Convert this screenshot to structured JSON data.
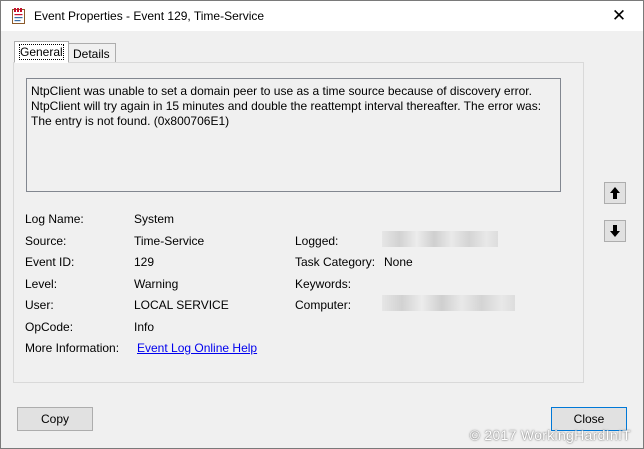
{
  "window": {
    "title": "Event Properties - Event 129, Time-Service",
    "close_glyph": "✕"
  },
  "tabs": [
    {
      "label": "General",
      "selected": true
    },
    {
      "label": "Details",
      "selected": false
    }
  ],
  "description": "NtpClient was unable to set a domain peer to use as a time source because of discovery error. NtpClient will try again in 15 minutes and double the reattempt interval thereafter. The error was: The entry is not found. (0x800706E1)",
  "fields": {
    "log_name": {
      "label": "Log Name:",
      "value": "System"
    },
    "source": {
      "label": "Source:",
      "value": "Time-Service"
    },
    "event_id": {
      "label": "Event ID:",
      "value": "129"
    },
    "level": {
      "label": "Level:",
      "value": "Warning"
    },
    "user": {
      "label": "User:",
      "value": "LOCAL SERVICE"
    },
    "opcode": {
      "label": "OpCode:",
      "value": "Info"
    },
    "more_info": {
      "label": "More Information:",
      "value": "Event Log Online Help"
    },
    "logged": {
      "label": "Logged:"
    },
    "task_category": {
      "label": "Task Category:",
      "value": "None"
    },
    "keywords": {
      "label": "Keywords:"
    },
    "computer": {
      "label": "Computer:"
    }
  },
  "buttons": {
    "copy": "Copy",
    "close": "Close"
  },
  "icons": {
    "up": "arrow-up-icon",
    "down": "arrow-down-icon",
    "app": "event-viewer-icon"
  },
  "watermark": "© 2017 WorkingHardInIT"
}
